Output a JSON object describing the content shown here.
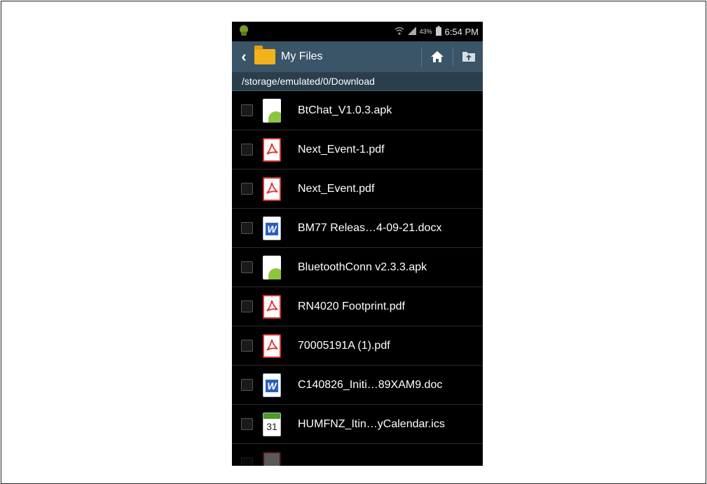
{
  "status_bar": {
    "battery_pct": "43%",
    "time": "6:54 PM",
    "icons": [
      "android-notification-icon",
      "wifi-icon",
      "signal-icon",
      "battery-icon"
    ]
  },
  "action_bar": {
    "title": "My Files",
    "icons": [
      "back-icon",
      "folder-icon",
      "home-icon",
      "up-folder-icon"
    ],
    "colors": {
      "background": "#3a5468",
      "folder": "#f2b21b"
    }
  },
  "path": "/storage/emulated/0/Download",
  "files": [
    {
      "name": "BtChat_V1.0.3.apk",
      "type": "apk"
    },
    {
      "name": "Next_Event-1.pdf",
      "type": "pdf"
    },
    {
      "name": "Next_Event.pdf",
      "type": "pdf"
    },
    {
      "name": "BM77 Releas…4-09-21.docx",
      "type": "doc"
    },
    {
      "name": "BluetoothConn v2.3.3.apk",
      "type": "apk"
    },
    {
      "name": "RN4020 Footprint.pdf",
      "type": "pdf"
    },
    {
      "name": "70005191A (1).pdf",
      "type": "pdf"
    },
    {
      "name": "C140826_Initi…89XAM9.doc",
      "type": "doc"
    },
    {
      "name": "HUMFNZ_Itin…yCalendar.ics",
      "type": "ics",
      "calendar_day": "31"
    }
  ]
}
